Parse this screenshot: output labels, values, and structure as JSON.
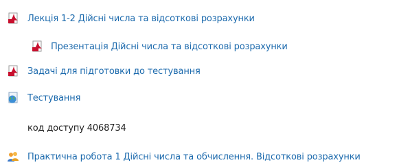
{
  "items": [
    {
      "icon": "pdf-icon",
      "label": "Лекція 1-2 Дійсні числа та відсоткові розрахунки"
    },
    {
      "icon": "pdf-icon",
      "label": "Презентація Дійсні числа та відсоткові розрахунки"
    },
    {
      "icon": "pdf-icon",
      "label": "Задачі для підготовки до тестування"
    },
    {
      "icon": "quiz-globe-icon",
      "label": "Тестування"
    },
    {
      "icon": "",
      "label": "код доступу 4068734"
    },
    {
      "icon": "workshop-users-icon",
      "label": "Практична робота 1 Дійсні числа та обчислення. Відсоткові розрахунки"
    }
  ],
  "colors": {
    "link": "#1c6aad",
    "text": "#222222",
    "pdf_red": "#c8102e"
  }
}
